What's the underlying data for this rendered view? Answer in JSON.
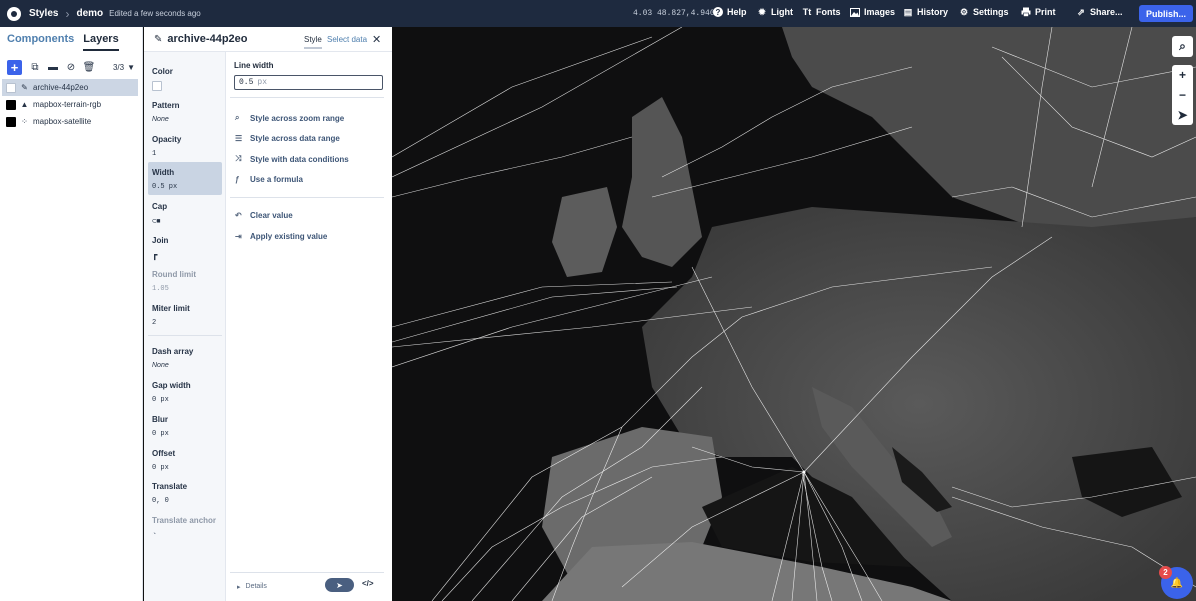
{
  "topbar": {
    "app": "Styles",
    "style_name": "demo",
    "edited": "Edited a few seconds ago",
    "coords": "4.03 48.827,4.940",
    "help": "Help",
    "light": "Light",
    "fonts": "Fonts",
    "images": "Images",
    "history": "History",
    "settings": "Settings",
    "print": "Print",
    "share": "Share...",
    "publish": "Publish..."
  },
  "left": {
    "tab_components": "Components",
    "tab_layers": "Layers",
    "layer_count": "3/3",
    "layers": [
      {
        "name": "archive-44p2eo",
        "icon": "pencil-icon"
      },
      {
        "name": "mapbox-terrain-rgb",
        "icon": "mountain-icon"
      },
      {
        "name": "mapbox-satellite",
        "icon": "raster-icon"
      }
    ]
  },
  "editor": {
    "layer_name": "archive-44p2eo",
    "tab_style": "Style",
    "tab_select_data": "Select data",
    "props": {
      "color": {
        "label": "Color"
      },
      "pattern": {
        "label": "Pattern",
        "value": "None"
      },
      "opacity": {
        "label": "Opacity",
        "value": "1"
      },
      "width": {
        "label": "Width",
        "value": "0.5 px"
      },
      "cap": {
        "label": "Cap"
      },
      "join": {
        "label": "Join"
      },
      "round_limit": {
        "label": "Round limit",
        "value": "1.05"
      },
      "miter_limit": {
        "label": "Miter limit",
        "value": "2"
      },
      "dash_array": {
        "label": "Dash array",
        "value": "None"
      },
      "gap_width": {
        "label": "Gap width",
        "value": "0 px"
      },
      "blur": {
        "label": "Blur",
        "value": "0 px"
      },
      "offset": {
        "label": "Offset",
        "value": "0 px"
      },
      "translate": {
        "label": "Translate",
        "value": "0, 0"
      },
      "translate_anchor": {
        "label": "Translate anchor"
      }
    },
    "form": {
      "label": "Line width",
      "value": "0.5",
      "unit": "px",
      "opt_zoom": "Style across zoom range",
      "opt_data": "Style across data range",
      "opt_conditions": "Style with data conditions",
      "opt_formula": "Use a formula",
      "clear": "Clear value",
      "apply": "Apply existing value",
      "details": "Details"
    }
  },
  "notifications": {
    "count": "2"
  },
  "colors": {
    "accent": "#3b63ea",
    "topbar": "#1e2a3f",
    "map_bg": "#0f0f10",
    "route": "#ffffff"
  }
}
